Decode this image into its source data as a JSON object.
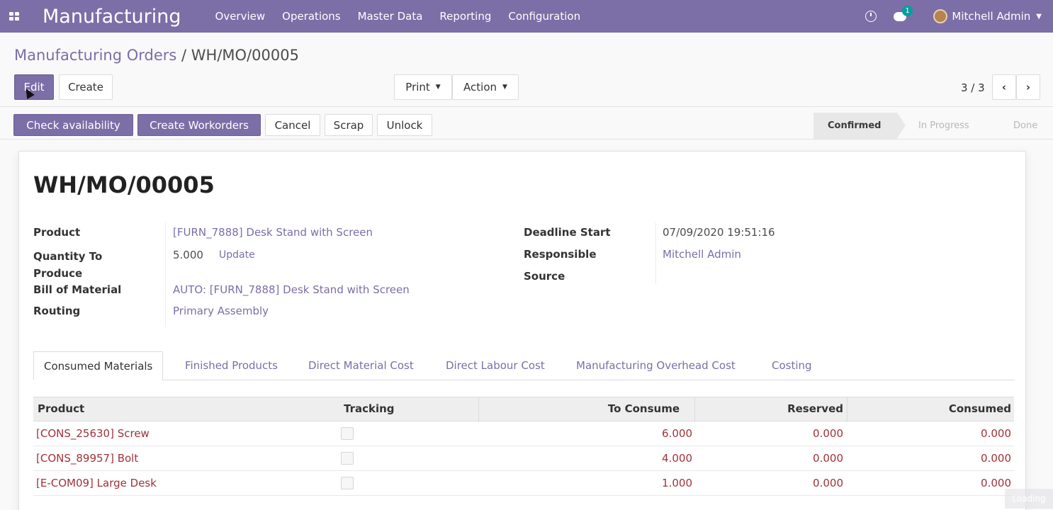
{
  "navbar": {
    "app_name": "Manufacturing",
    "menu": [
      "Overview",
      "Operations",
      "Master Data",
      "Reporting",
      "Configuration"
    ],
    "chat_count": "1",
    "user_name": "Mitchell Admin",
    "color": "#7c6ea6"
  },
  "breadcrumb": {
    "parent": "Manufacturing Orders",
    "separator": " / ",
    "current": "WH/MO/00005"
  },
  "buttons": {
    "edit": "Edit",
    "create": "Create",
    "print": "Print",
    "action": "Action"
  },
  "pager": {
    "value": "3 / 3"
  },
  "statusbar": {
    "buttons": [
      "Check availability",
      "Create Workorders",
      "Cancel",
      "Scrap",
      "Unlock"
    ],
    "stages": [
      "Confirmed",
      "In Progress",
      "Done"
    ],
    "active_stage": "Confirmed"
  },
  "record": {
    "title": "WH/MO/00005",
    "fields_left": {
      "product_label": "Product",
      "product_value": "[FURN_7888] Desk Stand with Screen",
      "quantity_label": "Quantity To Produce",
      "quantity_value": "5.000",
      "update_label": "Update",
      "bom_label": "Bill of Material",
      "bom_value": "AUTO: [FURN_7888] Desk Stand with Screen",
      "routing_label": "Routing",
      "routing_value": "Primary Assembly"
    },
    "fields_right": {
      "deadline_label": "Deadline Start",
      "deadline_value": "07/09/2020 19:51:16",
      "responsible_label": "Responsible",
      "responsible_value": "Mitchell Admin",
      "source_label": "Source",
      "source_value": ""
    }
  },
  "tabs": [
    "Consumed Materials",
    "Finished Products",
    "Direct Material Cost",
    "Direct Labour Cost",
    "Manufacturing Overhead Cost",
    "Costing"
  ],
  "table": {
    "headers": [
      "Product",
      "Tracking",
      "To Consume",
      "Reserved",
      "Consumed"
    ],
    "rows": [
      {
        "product": "[CONS_25630] Screw",
        "to_consume": "6.000",
        "reserved": "0.000",
        "consumed": "0.000"
      },
      {
        "product": "[CONS_89957] Bolt",
        "to_consume": "4.000",
        "reserved": "0.000",
        "consumed": "0.000"
      },
      {
        "product": "[E-COM09] Large Desk",
        "to_consume": "1.000",
        "reserved": "0.000",
        "consumed": "0.000"
      }
    ]
  },
  "watermark": "Loading"
}
